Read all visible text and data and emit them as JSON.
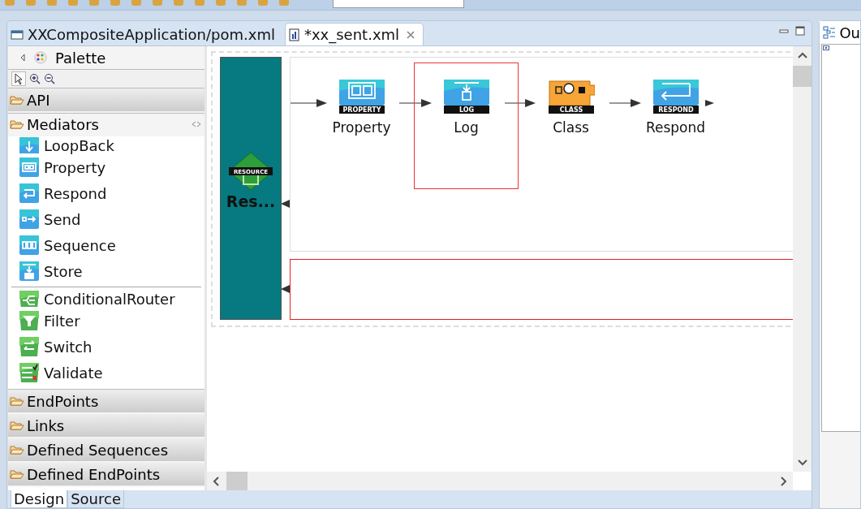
{
  "editor_tabs": [
    {
      "label": "XXCompositeApplication/pom.xml",
      "selected": false,
      "kind": "window"
    },
    {
      "label": "*xx_sent.xml",
      "selected": true,
      "kind": "file",
      "closable": true
    }
  ],
  "palette": {
    "title": "Palette",
    "groups": [
      {
        "label": "API",
        "expanded": false
      },
      {
        "label": "Mediators",
        "expanded": true,
        "sections": [
          [
            {
              "label": "LoopBack",
              "kind": "loopback"
            },
            {
              "label": "Property",
              "kind": "property"
            },
            {
              "label": "Respond",
              "kind": "respond"
            },
            {
              "label": "Send",
              "kind": "send"
            },
            {
              "label": "Sequence",
              "kind": "sequence"
            },
            {
              "label": "Store",
              "kind": "store"
            }
          ],
          [
            {
              "label": "ConditionalRouter",
              "kind": "router"
            },
            {
              "label": "Filter",
              "kind": "filter"
            },
            {
              "label": "Switch",
              "kind": "switch"
            },
            {
              "label": "Validate",
              "kind": "validate"
            }
          ]
        ]
      },
      {
        "label": "EndPoints",
        "expanded": false
      },
      {
        "label": "Links",
        "expanded": false
      },
      {
        "label": "Defined Sequences",
        "expanded": false
      },
      {
        "label": "Defined EndPoints",
        "expanded": false
      }
    ]
  },
  "diagram": {
    "resource": {
      "badge": "RESOURCE",
      "label": "Res..."
    },
    "nodes": [
      {
        "label": "Property",
        "badge": "PROPERTY",
        "kind": "property",
        "selected": false
      },
      {
        "label": "Log",
        "badge": "LOG",
        "kind": "log",
        "selected": true
      },
      {
        "label": "Class",
        "badge": "CLASS",
        "kind": "class",
        "selected": false
      },
      {
        "label": "Respond",
        "badge": "RESPOND",
        "kind": "respond",
        "selected": false
      }
    ],
    "fault_lane": {
      "selected": true
    }
  },
  "bottom_tabs": [
    {
      "label": "Design",
      "selected": true
    },
    {
      "label": "Source",
      "selected": false
    }
  ],
  "outline": {
    "title": "Ou"
  }
}
